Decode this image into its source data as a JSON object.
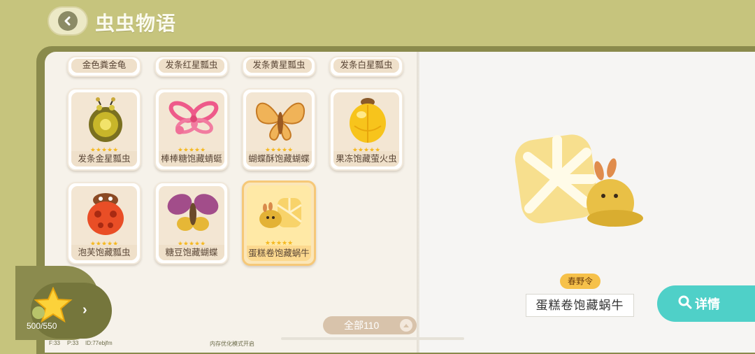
{
  "header": {
    "title": "虫虫物语"
  },
  "grid": {
    "top_row": [
      {
        "name": "金色粪金龟"
      },
      {
        "name": "发条红星瓢虫"
      },
      {
        "name": "发条黄星瓢虫"
      },
      {
        "name": "发条白星瓢虫"
      }
    ],
    "cards": [
      {
        "name": "发条金星瓢虫",
        "stars": "★★★★★",
        "icon": "golden-ladybug-icon"
      },
      {
        "name": "棒棒糖饱藏蜻蜓",
        "stars": "★★★★★",
        "icon": "lollipop-dragonfly-icon"
      },
      {
        "name": "蝴蝶酥饱藏蝴蝶",
        "stars": "★★★★★",
        "icon": "pastry-butterfly-icon"
      },
      {
        "name": "果冻饱藏萤火虫",
        "stars": "★★★★★",
        "icon": "jelly-firefly-icon"
      },
      {
        "name": "泡芙饱藏瓢虫",
        "stars": "★★★★★",
        "icon": "puff-ladybug-icon"
      },
      {
        "name": "糖豆饱藏蝴蝶",
        "stars": "★★★★★",
        "icon": "candy-butterfly-icon"
      },
      {
        "name": "蛋糕卷饱藏蜗牛",
        "stars": "★★★★★",
        "icon": "cake-snail-icon",
        "selected": true
      }
    ]
  },
  "filter": {
    "label": "全部110"
  },
  "collection": {
    "count": "500/550"
  },
  "detail": {
    "tag": "春野令",
    "item_name": "蛋糕卷饱藏蜗牛",
    "button_label": "详情"
  },
  "footer": {
    "left1": "F:33",
    "left2": "P:33",
    "id": "ID:77ebjfm",
    "mid": "内存优化模式开启"
  },
  "colors": {
    "accent": "#4fd0c8",
    "star": "#f5b820",
    "tag": "#f6c14a",
    "background": "#c6c47d"
  }
}
